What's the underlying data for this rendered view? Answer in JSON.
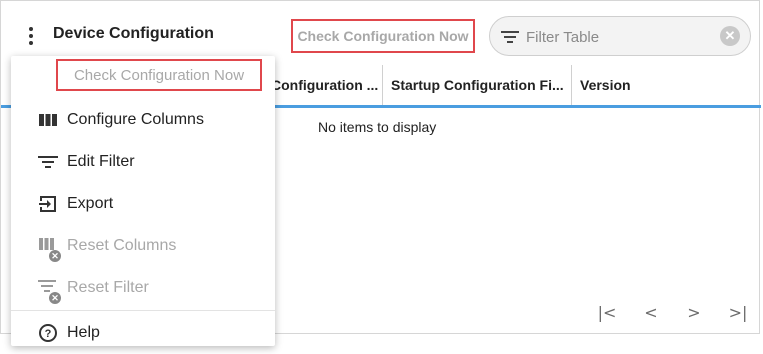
{
  "header": {
    "title": "Device Configuration",
    "check_button_label": "Check Configuration Now"
  },
  "filter": {
    "placeholder": "Filter Table"
  },
  "table": {
    "columns": [
      "Configuration ...",
      "Startup Configuration Fi...",
      "Version"
    ],
    "empty_message": "No items to display"
  },
  "menu": {
    "check_label": "Check Configuration Now",
    "items": [
      {
        "label": "Configure Columns",
        "icon": "columns-icon",
        "disabled": false
      },
      {
        "label": "Edit Filter",
        "icon": "filter-icon",
        "disabled": false
      },
      {
        "label": "Export",
        "icon": "export-icon",
        "disabled": false
      },
      {
        "label": "Reset Columns",
        "icon": "reset-columns-icon",
        "disabled": true
      },
      {
        "label": "Reset Filter",
        "icon": "reset-filter-icon",
        "disabled": true
      },
      {
        "label": "Help",
        "icon": "help-icon",
        "disabled": false
      }
    ]
  },
  "pagination": {
    "first": "|<",
    "prev": "<",
    "next": ">",
    "last": ">|"
  },
  "colors": {
    "highlight_border": "#e0474c",
    "header_underline": "#4a9de0",
    "disabled_text": "#a8a8a8"
  }
}
